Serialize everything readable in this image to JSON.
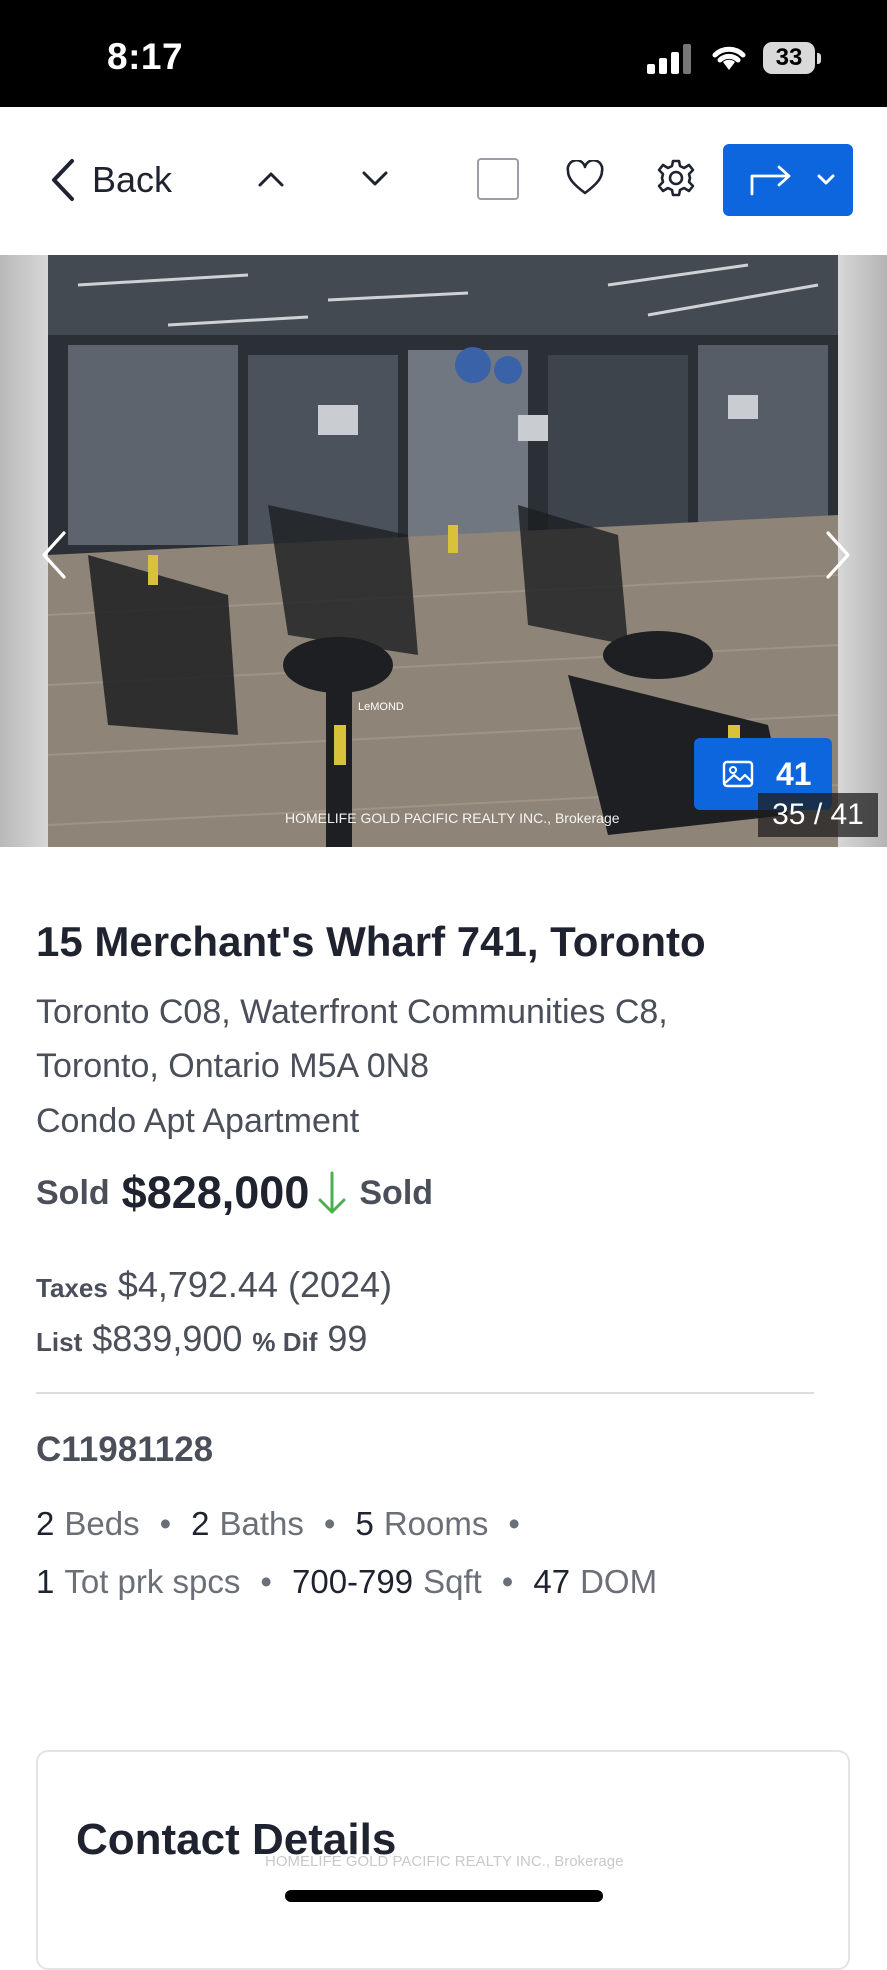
{
  "status_bar": {
    "time": "8:17",
    "battery": "33"
  },
  "nav": {
    "back_label": "Back"
  },
  "gallery": {
    "photo_count": "41",
    "photo_index": "35 / 41",
    "watermark": "HOMELIFE GOLD PACIFIC REALTY INC., Brokerage",
    "seat_brand": "LeMOND"
  },
  "listing": {
    "address": "15 Merchant's Wharf 741, Toronto",
    "area_line1": "Toronto C08, Waterfront Communities C8,",
    "area_line2": "Toronto, Ontario M5A 0N8",
    "property_type": "Condo Apt Apartment",
    "sold_label": "Sold",
    "sold_price": "$828,000",
    "status": "Sold",
    "taxes_label": "Taxes",
    "taxes_value": "$4,792.44 (2024)",
    "list_label": "List",
    "list_value": "$839,900",
    "dif_label": "% Dif",
    "dif_value": "99",
    "mls_number": "C11981128",
    "beds_num": "2",
    "beds_label": "Beds",
    "baths_num": "2",
    "baths_label": "Baths",
    "rooms_num": "5",
    "rooms_label": "Rooms",
    "parking_num": "1",
    "parking_label": "Tot prk spcs",
    "sqft_num": "700-799",
    "sqft_label": "Sqft",
    "dom_num": "47",
    "dom_label": "DOM"
  },
  "contact": {
    "title": "Contact Details",
    "watermark": "HOMELIFE GOLD PACIFIC REALTY INC., Brokerage"
  },
  "colors": {
    "accent": "#0e66de",
    "price_down_arrow": "#4caf50"
  }
}
